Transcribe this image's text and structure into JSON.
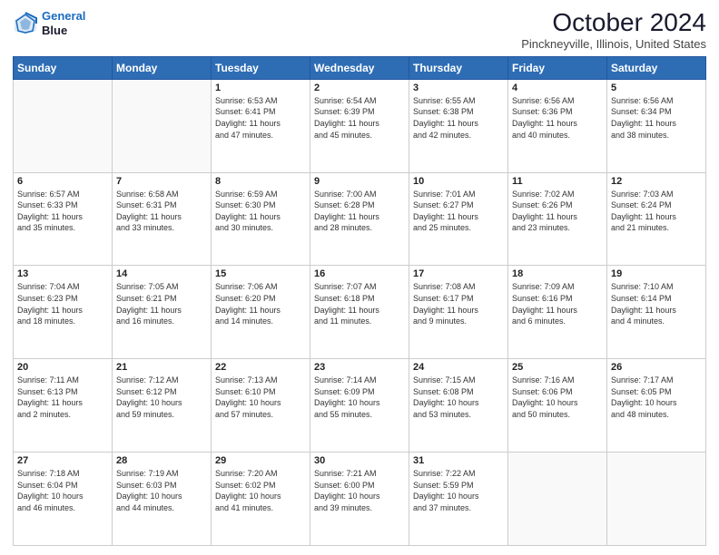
{
  "header": {
    "logo_line1": "General",
    "logo_line2": "Blue",
    "month": "October 2024",
    "location": "Pinckneyville, Illinois, United States"
  },
  "days_of_week": [
    "Sunday",
    "Monday",
    "Tuesday",
    "Wednesday",
    "Thursday",
    "Friday",
    "Saturday"
  ],
  "weeks": [
    [
      {
        "day": "",
        "info": ""
      },
      {
        "day": "",
        "info": ""
      },
      {
        "day": "1",
        "info": "Sunrise: 6:53 AM\nSunset: 6:41 PM\nDaylight: 11 hours\nand 47 minutes."
      },
      {
        "day": "2",
        "info": "Sunrise: 6:54 AM\nSunset: 6:39 PM\nDaylight: 11 hours\nand 45 minutes."
      },
      {
        "day": "3",
        "info": "Sunrise: 6:55 AM\nSunset: 6:38 PM\nDaylight: 11 hours\nand 42 minutes."
      },
      {
        "day": "4",
        "info": "Sunrise: 6:56 AM\nSunset: 6:36 PM\nDaylight: 11 hours\nand 40 minutes."
      },
      {
        "day": "5",
        "info": "Sunrise: 6:56 AM\nSunset: 6:34 PM\nDaylight: 11 hours\nand 38 minutes."
      }
    ],
    [
      {
        "day": "6",
        "info": "Sunrise: 6:57 AM\nSunset: 6:33 PM\nDaylight: 11 hours\nand 35 minutes."
      },
      {
        "day": "7",
        "info": "Sunrise: 6:58 AM\nSunset: 6:31 PM\nDaylight: 11 hours\nand 33 minutes."
      },
      {
        "day": "8",
        "info": "Sunrise: 6:59 AM\nSunset: 6:30 PM\nDaylight: 11 hours\nand 30 minutes."
      },
      {
        "day": "9",
        "info": "Sunrise: 7:00 AM\nSunset: 6:28 PM\nDaylight: 11 hours\nand 28 minutes."
      },
      {
        "day": "10",
        "info": "Sunrise: 7:01 AM\nSunset: 6:27 PM\nDaylight: 11 hours\nand 25 minutes."
      },
      {
        "day": "11",
        "info": "Sunrise: 7:02 AM\nSunset: 6:26 PM\nDaylight: 11 hours\nand 23 minutes."
      },
      {
        "day": "12",
        "info": "Sunrise: 7:03 AM\nSunset: 6:24 PM\nDaylight: 11 hours\nand 21 minutes."
      }
    ],
    [
      {
        "day": "13",
        "info": "Sunrise: 7:04 AM\nSunset: 6:23 PM\nDaylight: 11 hours\nand 18 minutes."
      },
      {
        "day": "14",
        "info": "Sunrise: 7:05 AM\nSunset: 6:21 PM\nDaylight: 11 hours\nand 16 minutes."
      },
      {
        "day": "15",
        "info": "Sunrise: 7:06 AM\nSunset: 6:20 PM\nDaylight: 11 hours\nand 14 minutes."
      },
      {
        "day": "16",
        "info": "Sunrise: 7:07 AM\nSunset: 6:18 PM\nDaylight: 11 hours\nand 11 minutes."
      },
      {
        "day": "17",
        "info": "Sunrise: 7:08 AM\nSunset: 6:17 PM\nDaylight: 11 hours\nand 9 minutes."
      },
      {
        "day": "18",
        "info": "Sunrise: 7:09 AM\nSunset: 6:16 PM\nDaylight: 11 hours\nand 6 minutes."
      },
      {
        "day": "19",
        "info": "Sunrise: 7:10 AM\nSunset: 6:14 PM\nDaylight: 11 hours\nand 4 minutes."
      }
    ],
    [
      {
        "day": "20",
        "info": "Sunrise: 7:11 AM\nSunset: 6:13 PM\nDaylight: 11 hours\nand 2 minutes."
      },
      {
        "day": "21",
        "info": "Sunrise: 7:12 AM\nSunset: 6:12 PM\nDaylight: 10 hours\nand 59 minutes."
      },
      {
        "day": "22",
        "info": "Sunrise: 7:13 AM\nSunset: 6:10 PM\nDaylight: 10 hours\nand 57 minutes."
      },
      {
        "day": "23",
        "info": "Sunrise: 7:14 AM\nSunset: 6:09 PM\nDaylight: 10 hours\nand 55 minutes."
      },
      {
        "day": "24",
        "info": "Sunrise: 7:15 AM\nSunset: 6:08 PM\nDaylight: 10 hours\nand 53 minutes."
      },
      {
        "day": "25",
        "info": "Sunrise: 7:16 AM\nSunset: 6:06 PM\nDaylight: 10 hours\nand 50 minutes."
      },
      {
        "day": "26",
        "info": "Sunrise: 7:17 AM\nSunset: 6:05 PM\nDaylight: 10 hours\nand 48 minutes."
      }
    ],
    [
      {
        "day": "27",
        "info": "Sunrise: 7:18 AM\nSunset: 6:04 PM\nDaylight: 10 hours\nand 46 minutes."
      },
      {
        "day": "28",
        "info": "Sunrise: 7:19 AM\nSunset: 6:03 PM\nDaylight: 10 hours\nand 44 minutes."
      },
      {
        "day": "29",
        "info": "Sunrise: 7:20 AM\nSunset: 6:02 PM\nDaylight: 10 hours\nand 41 minutes."
      },
      {
        "day": "30",
        "info": "Sunrise: 7:21 AM\nSunset: 6:00 PM\nDaylight: 10 hours\nand 39 minutes."
      },
      {
        "day": "31",
        "info": "Sunrise: 7:22 AM\nSunset: 5:59 PM\nDaylight: 10 hours\nand 37 minutes."
      },
      {
        "day": "",
        "info": ""
      },
      {
        "day": "",
        "info": ""
      }
    ]
  ]
}
